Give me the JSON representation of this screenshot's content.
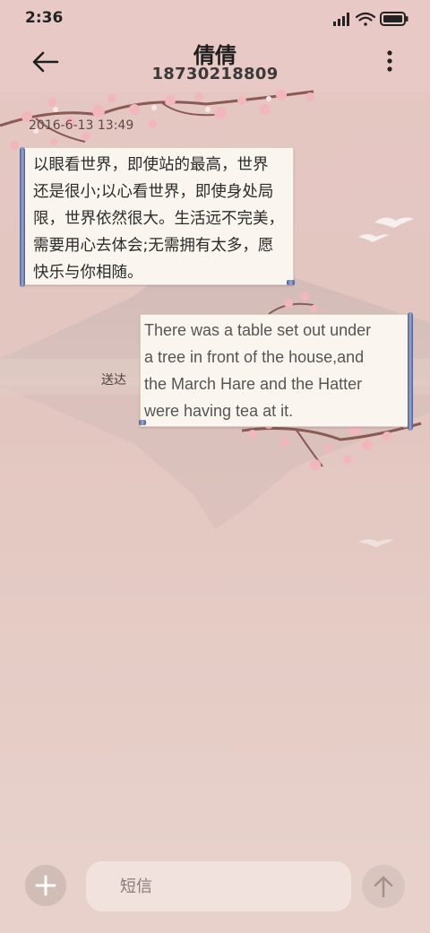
{
  "status_bar": {
    "time": "2:36",
    "icons": [
      "signal-icon",
      "wifi-icon",
      "battery-icon"
    ]
  },
  "header": {
    "title": "倩倩",
    "subtitle": "18730218809",
    "back_icon": "back-arrow-icon",
    "more_icon": "more-vertical-icon"
  },
  "conversation": {
    "timestamp": "2016-6-13 13:49",
    "messages": [
      {
        "direction": "incoming",
        "lines": [
          "以眼看世界，即使站的最高，世界",
          "还是很小;以心看世界，即使身处局",
          "限，世界依然很大。生活远不完美，",
          "需要用心去体会;无需拥有太多，愿",
          "快乐与你相随。"
        ]
      },
      {
        "direction": "outgoing",
        "status": "送达",
        "lines": [
          "There was a table set out under",
          "a tree in front of the house,and",
          "the March Hare and the Hatter",
          "were having tea at it."
        ]
      }
    ]
  },
  "composer": {
    "placeholder": "短信",
    "value": "",
    "add_icon": "plus-icon",
    "send_icon": "arrow-up-icon"
  },
  "colors": {
    "header_bg": "#e9c9c5",
    "bubble_bg": "#faf6ef",
    "rod": "#4b5c8e"
  }
}
